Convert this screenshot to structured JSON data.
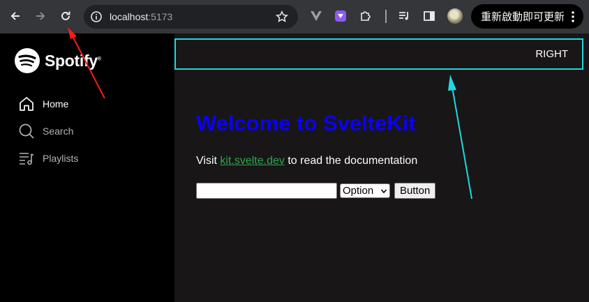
{
  "browser": {
    "url_host": "localhost",
    "url_port": ":5173",
    "update_button_label": "重新啟動即可更新"
  },
  "sidebar": {
    "brand": "Spotify",
    "brand_mark": "®",
    "items": [
      {
        "label": "Home",
        "icon": "home-icon",
        "active": true
      },
      {
        "label": "Search",
        "icon": "search-icon",
        "active": false
      },
      {
        "label": "Playlists",
        "icon": "playlist-icon",
        "active": false
      }
    ]
  },
  "main": {
    "header_right": "RIGHT",
    "title": "Welcome to SvelteKit",
    "visit_prefix": "Visit ",
    "visit_link": "kit.svelte.dev",
    "visit_suffix": " to read the documentation",
    "input_value": "",
    "select_value": "Option",
    "button_label": "Button"
  },
  "colors": {
    "header_border": "#1fd8e0",
    "title": "#0a00ff",
    "link": "#2fa84f",
    "arrow_red": "#ff1a1a",
    "arrow_cyan": "#1fd8e0"
  }
}
